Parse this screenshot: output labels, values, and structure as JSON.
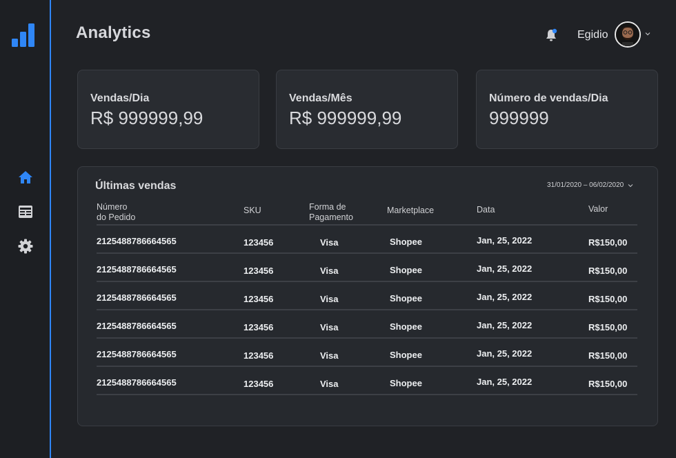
{
  "app": {
    "title": "Analytics"
  },
  "colors": {
    "accent": "#2f86f6",
    "background": "#202226",
    "card": "#292c31"
  },
  "sidebar": {
    "logo_icon": "bar-chart-icon",
    "items": [
      {
        "icon": "home-icon",
        "active": true
      },
      {
        "icon": "newspaper-icon",
        "active": false
      },
      {
        "icon": "gear-icon",
        "active": false
      }
    ]
  },
  "header": {
    "user_name": "Egidio",
    "notification_icon": "bell-icon",
    "has_notification": true
  },
  "cards": [
    {
      "label": "Vendas/Dia",
      "value": "R$ 999999,99"
    },
    {
      "label": "Vendas/Mês",
      "value": "R$ 999999,99"
    },
    {
      "label": "Número de vendas/Dia",
      "value": "999999"
    }
  ],
  "sales": {
    "title": "Últimas vendas",
    "date_range": "31/01/2020 – 06/02/2020",
    "columns": [
      {
        "line1": "Número",
        "line2": "do Pedido"
      },
      {
        "line1": "SKU",
        "line2": ""
      },
      {
        "line1": "Forma de",
        "line2": "Pagamento"
      },
      {
        "line1": "Marketplace",
        "line2": ""
      },
      {
        "line1": "Data",
        "line2": ""
      },
      {
        "line1": "Valor",
        "line2": ""
      }
    ],
    "rows": [
      [
        "2125488786664565",
        "123456",
        "Visa",
        "Shopee",
        "Jan, 25, 2022",
        "R$150,00"
      ],
      [
        "2125488786664565",
        "123456",
        "Visa",
        "Shopee",
        "Jan, 25, 2022",
        "R$150,00"
      ],
      [
        "2125488786664565",
        "123456",
        "Visa",
        "Shopee",
        "Jan, 25, 2022",
        "R$150,00"
      ],
      [
        "2125488786664565",
        "123456",
        "Visa",
        "Shopee",
        "Jan, 25, 2022",
        "R$150,00"
      ],
      [
        "2125488786664565",
        "123456",
        "Visa",
        "Shopee",
        "Jan, 25, 2022",
        "R$150,00"
      ],
      [
        "2125488786664565",
        "123456",
        "Visa",
        "Shopee",
        "Jan, 25, 2022",
        "R$150,00"
      ]
    ]
  }
}
